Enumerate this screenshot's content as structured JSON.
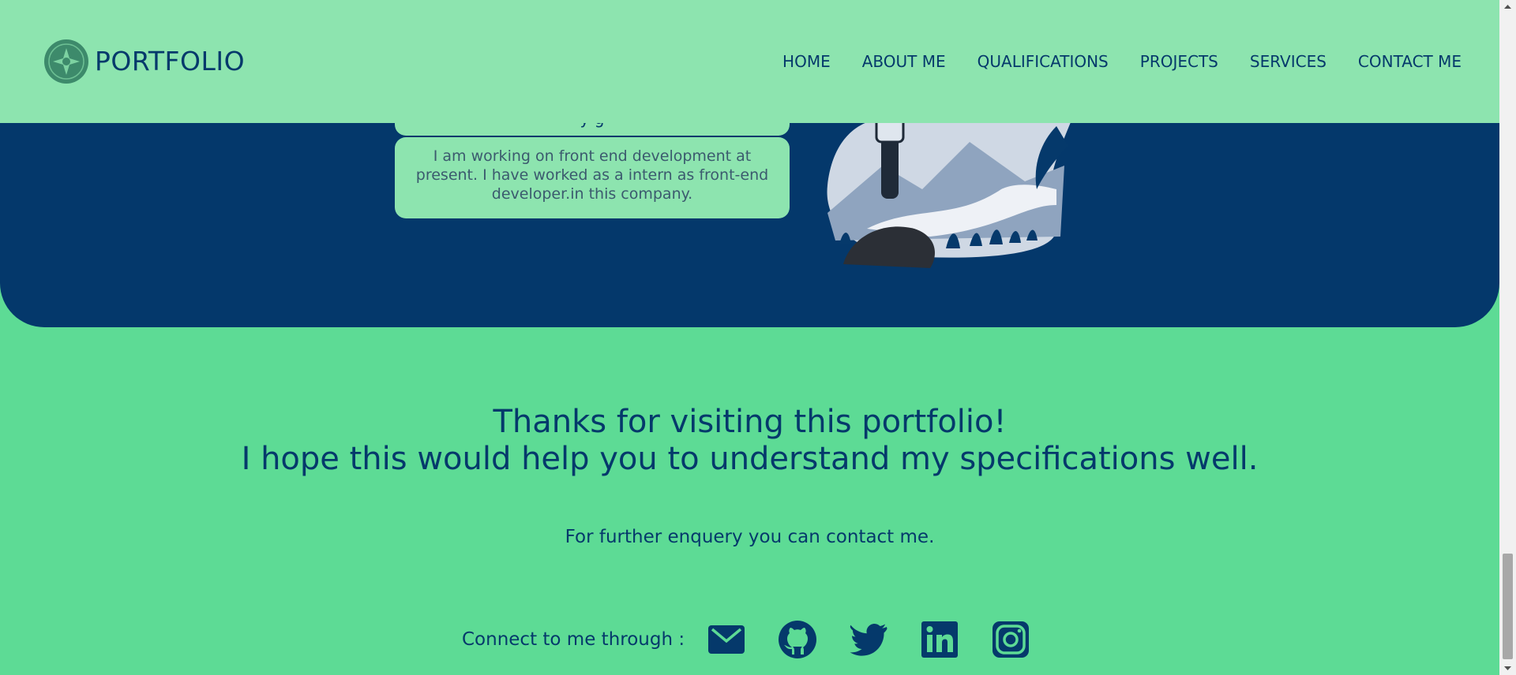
{
  "navbar": {
    "brand": "PORTFOLIO",
    "links": [
      "HOME",
      "ABOUT ME",
      "QUALIFICATIONS",
      "PROJECTS",
      "SERVICES",
      "CONTACT ME"
    ]
  },
  "experience": {
    "card_text": "I am working on front end development at present. I have worked as a intern as front-end developer.in this company."
  },
  "footer": {
    "thanks_line1": "Thanks for visiting this portfolio!",
    "thanks_line2": "I hope this would help you to understand my specifications well.",
    "enquiry": "For further enquery you can contact me.",
    "connect_label": "Connect to me through :",
    "social_icons": [
      "mail-icon",
      "github-icon",
      "twitter-icon",
      "linkedin-icon",
      "instagram-icon"
    ]
  },
  "colors": {
    "page_bg": "#5ddb95",
    "navbar_bg": "#8de4af",
    "dark_section_bg": "#04386b",
    "text": "#05396b"
  }
}
